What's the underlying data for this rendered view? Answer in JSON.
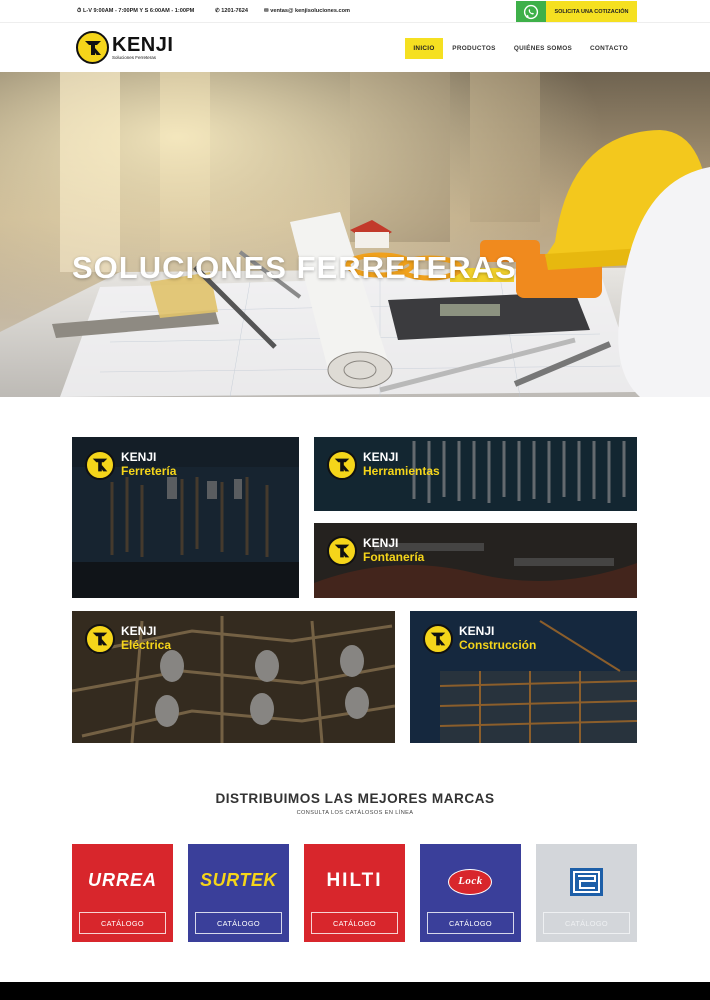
{
  "topbar": {
    "hours": "L-V 9:00AM - 7:00PM Y S 6:00AM - 1:00PM",
    "phone": "1201-7624",
    "email": "ventas@ kenjisoluciones.com",
    "quote_label": "SOLICITA UNA COTIZACIÓN"
  },
  "header": {
    "logo_name": "KENJI",
    "logo_tagline": "Soluciones Ferreteras",
    "nav": [
      "INICIO",
      "PRODUCTOS",
      "QUIÉNES SOMOS",
      "CONTACTO"
    ],
    "active_nav": "INICIO"
  },
  "hero": {
    "title": "SOLUCIONES FERRETERAS"
  },
  "categories": [
    {
      "brand": "KENJI",
      "name": "Ferretería"
    },
    {
      "brand": "KENJI",
      "name": "Herramientas"
    },
    {
      "brand": "KENJI",
      "name": "Fontanería"
    },
    {
      "brand": "KENJI",
      "name": "Eléctrica"
    },
    {
      "brand": "KENJI",
      "name": "Construcción"
    }
  ],
  "brands_section": {
    "title": "DISTRIBUIMOS LAS MEJORES MARCAS",
    "subtitle": "CONSULTA LOS CATÁLOSOS EN LÍNEA"
  },
  "brands": [
    {
      "name": "URREA",
      "button": "CATÁLOGO",
      "color": "#d8262c"
    },
    {
      "name": "SURTEK",
      "button": "CATÁLOGO",
      "color": "#3a3f9a"
    },
    {
      "name": "HILTI",
      "button": "CATÁLOGO",
      "color": "#d8262c"
    },
    {
      "name": "Lock",
      "button": "CATÁLOGO",
      "color": "#3a3f9a"
    },
    {
      "name": "",
      "button": "CATÁLOGO",
      "color": "#d3d6da"
    }
  ],
  "colors": {
    "accent": "#f5e021",
    "whatsapp": "#3eb049"
  }
}
